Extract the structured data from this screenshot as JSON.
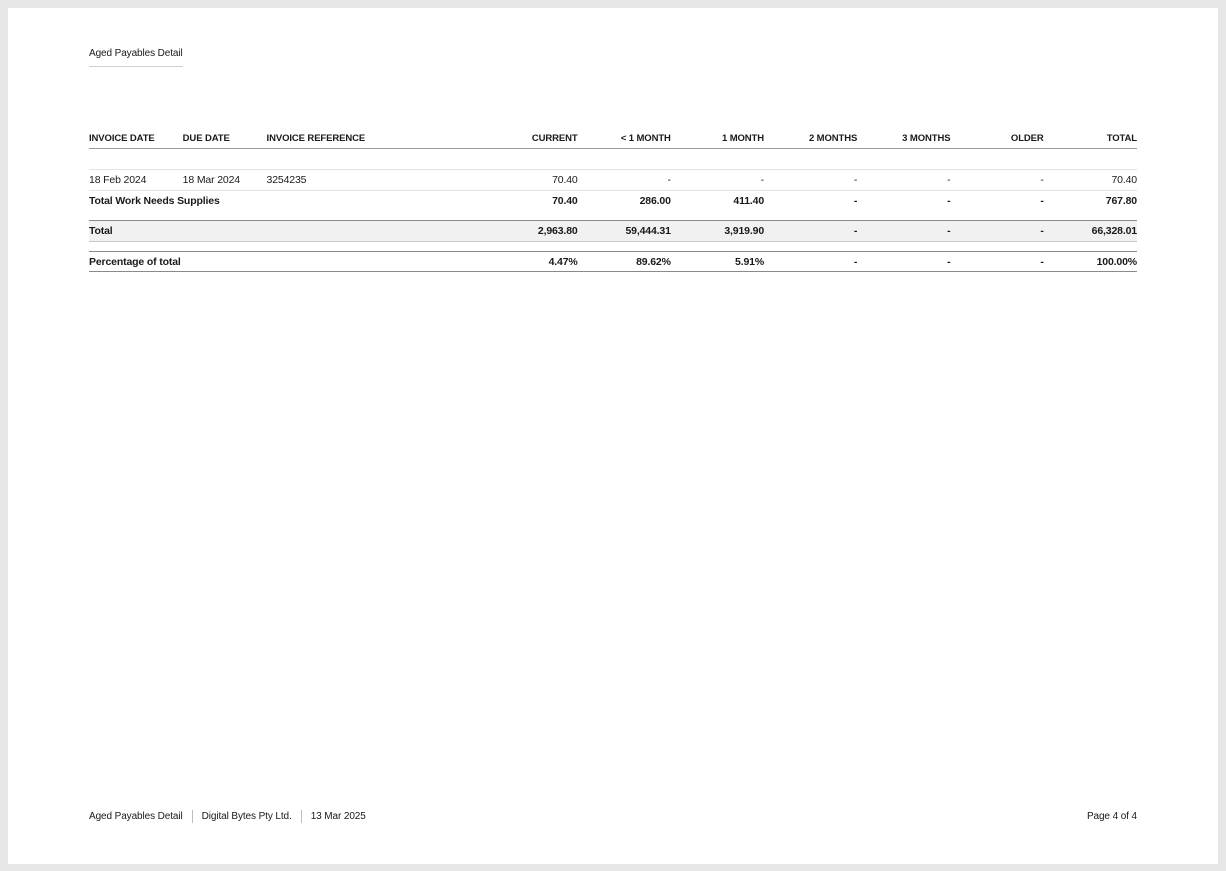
{
  "header": {
    "title": "Aged Payables Detail"
  },
  "table": {
    "columns": {
      "invoice_date": "INVOICE DATE",
      "due_date": "DUE DATE",
      "invoice_reference": "INVOICE REFERENCE",
      "current": "CURRENT",
      "lt1month": "< 1 MONTH",
      "m1": "1 MONTH",
      "m2": "2 MONTHS",
      "m3": "3 MONTHS",
      "older": "OLDER",
      "total": "TOTAL"
    },
    "line": {
      "invoice_date": "18 Feb 2024",
      "due_date": "18 Mar 2024",
      "invoice_reference": "3254235",
      "current": "70.40",
      "lt1month": "-",
      "m1": "-",
      "m2": "-",
      "m3": "-",
      "older": "-",
      "total": "70.40"
    },
    "subtotal": {
      "label": "Total Work Needs Supplies",
      "current": "70.40",
      "lt1month": "286.00",
      "m1": "411.40",
      "m2": "-",
      "m3": "-",
      "older": "-",
      "total": "767.80"
    },
    "grand_total": {
      "label": "Total",
      "current": "2,963.80",
      "lt1month": "59,444.31",
      "m1": "3,919.90",
      "m2": "-",
      "m3": "-",
      "older": "-",
      "total": "66,328.01"
    },
    "percentage": {
      "label": "Percentage of total",
      "current": "4.47%",
      "lt1month": "89.62%",
      "m1": "5.91%",
      "m2": "-",
      "m3": "-",
      "older": "-",
      "total": "100.00%"
    }
  },
  "footer": {
    "report_name": "Aged Payables Detail",
    "company": "Digital Bytes Pty Ltd.",
    "date": "13 Mar 2025",
    "page": "Page 4 of 4"
  }
}
